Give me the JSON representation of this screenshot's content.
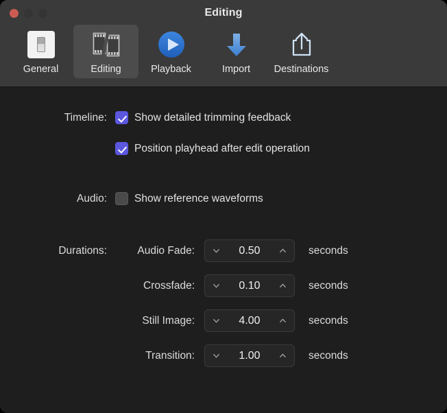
{
  "window": {
    "title": "Editing",
    "traffic_lights": [
      {
        "name": "close",
        "color": "#cc5c52"
      },
      {
        "name": "minimize",
        "color": "#343434"
      },
      {
        "name": "zoom",
        "color": "#343434"
      }
    ]
  },
  "toolbar": {
    "tabs": [
      {
        "label": "General",
        "icon": "light-switch-icon",
        "selected": false
      },
      {
        "label": "Editing",
        "icon": "film-strips-icon",
        "selected": true
      },
      {
        "label": "Playback",
        "icon": "play-circle-icon",
        "selected": false
      },
      {
        "label": "Import",
        "icon": "download-arrow-icon",
        "selected": false
      },
      {
        "label": "Destinations",
        "icon": "share-box-icon",
        "selected": false
      }
    ]
  },
  "main": {
    "timeline": {
      "label": "Timeline:",
      "options": [
        {
          "label": "Show detailed trimming feedback",
          "checked": true
        },
        {
          "label": "Position playhead after edit operation",
          "checked": true
        }
      ]
    },
    "audio": {
      "label": "Audio:",
      "options": [
        {
          "label": "Show reference waveforms",
          "checked": false
        }
      ]
    },
    "durations": {
      "label": "Durations:",
      "unit": "seconds",
      "fields": [
        {
          "label": "Audio Fade:",
          "value": "0.50"
        },
        {
          "label": "Crossfade:",
          "value": "0.10"
        },
        {
          "label": "Still Image:",
          "value": "4.00"
        },
        {
          "label": "Transition:",
          "value": "1.00"
        }
      ]
    }
  },
  "colors": {
    "checkbox_on": "#5b57de",
    "accent_blue": "#2f7cd6",
    "toolbar_bg": "#3a3a3a",
    "content_bg": "#1e1e1e"
  }
}
